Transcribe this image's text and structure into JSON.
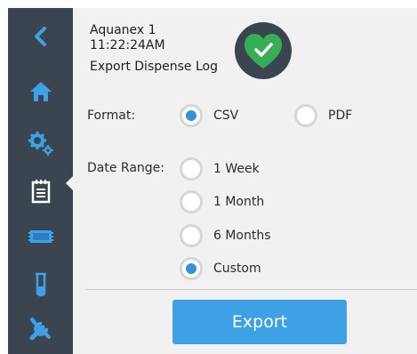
{
  "header": {
    "device": "Aquanex 1",
    "time": "11:22:24AM",
    "title": "Export Dispense Log"
  },
  "sidebar": {
    "items": [
      {
        "icon": "back-chevron-icon"
      },
      {
        "icon": "home-icon"
      },
      {
        "icon": "settings-gears-icon"
      },
      {
        "icon": "notepad-icon",
        "active": true
      },
      {
        "icon": "screen-icon"
      },
      {
        "icon": "beaker-icon"
      },
      {
        "icon": "tools-icon"
      }
    ]
  },
  "format": {
    "label": "Format:",
    "options": [
      {
        "label": "CSV",
        "selected": true
      },
      {
        "label": "PDF",
        "selected": false
      }
    ]
  },
  "date_range": {
    "label": "Date Range:",
    "options": [
      {
        "label": "1 Week",
        "selected": false
      },
      {
        "label": "1 Month",
        "selected": false
      },
      {
        "label": "6 Months",
        "selected": false
      },
      {
        "label": "Custom",
        "selected": true
      }
    ]
  },
  "actions": {
    "export_label": "Export"
  },
  "colors": {
    "sidebar": "#3a4550",
    "icon": "#3ea1e6",
    "active_icon": "#ffffff",
    "radio_selected": "#3a8fd6",
    "badge_bg": "#3a4550",
    "heart": "#37ae55",
    "button": "#3ea1e6"
  }
}
